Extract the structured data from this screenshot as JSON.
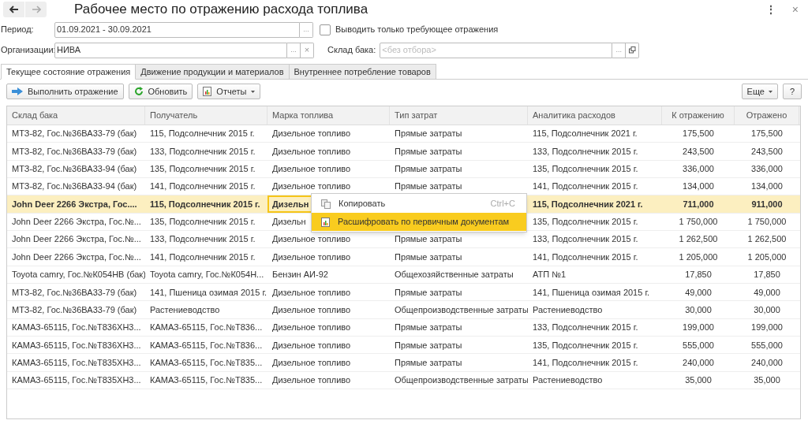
{
  "window": {
    "title": "Рабочее место по отражению расхода топлива",
    "menu_icon": "⋮",
    "close_icon": "×"
  },
  "filters": {
    "period_label": "Период:",
    "period_value": "01.09.2021 - 30.09.2021",
    "only_required": {
      "label": "Выводить только требующее отражения",
      "checked": false
    },
    "org_label": "Организации:",
    "org_value": "НИВА",
    "tank_label": "Склад бака:",
    "tank_placeholder": "<без отбора>",
    "select_dots": "...",
    "clear_icon": "×"
  },
  "tabs": [
    {
      "label": "Текущее состояние отражения",
      "selected": true
    },
    {
      "label": "Движение продукции и материалов",
      "selected": false
    },
    {
      "label": "Внутреннее потребление товаров",
      "selected": false
    }
  ],
  "toolbar": {
    "buttons": [
      {
        "kind": "post",
        "label": "Выполнить отражение"
      },
      {
        "kind": "refresh",
        "label": "Обновить"
      },
      {
        "kind": "reports",
        "label": "Отчеты"
      }
    ],
    "more": "Еще",
    "help": "?"
  },
  "table": {
    "columns": [
      "Склад бака",
      "Получатель",
      "Марка топлива",
      "Тип затрат",
      "Аналитика расходов",
      "К отражению",
      "Отражено"
    ],
    "rows": [
      {
        "selected": false,
        "cells": [
          {
            "text": "МТЗ-82, Гос.№36ВА33-79 (бак)",
            "focused": false
          },
          {
            "text": "115, Подсолнечник 2015 г.",
            "focused": false
          },
          {
            "text": "Дизельное топливо",
            "focused": false
          },
          {
            "text": "Прямые затраты",
            "focused": false
          },
          {
            "text": "115, Подсолнечник 2021 г.",
            "focused": false
          },
          {
            "text": "175,500",
            "focused": false
          },
          {
            "text": "175,500",
            "focused": false
          }
        ]
      },
      {
        "selected": false,
        "cells": [
          {
            "text": "МТЗ-82, Гос.№36ВА33-79 (бак)",
            "focused": false
          },
          {
            "text": "133, Подсолнечник 2015 г.",
            "focused": false
          },
          {
            "text": "Дизельное топливо",
            "focused": false
          },
          {
            "text": "Прямые затраты",
            "focused": false
          },
          {
            "text": "133, Подсолнечник 2015 г.",
            "focused": false
          },
          {
            "text": "243,500",
            "focused": false
          },
          {
            "text": "243,500",
            "focused": false
          }
        ]
      },
      {
        "selected": false,
        "cells": [
          {
            "text": "МТЗ-82, Гос.№36ВА33-94 (бак)",
            "focused": false
          },
          {
            "text": "135, Подсолнечник 2015 г.",
            "focused": false
          },
          {
            "text": "Дизельное топливо",
            "focused": false
          },
          {
            "text": "Прямые затраты",
            "focused": false
          },
          {
            "text": "135, Подсолнечник 2015 г.",
            "focused": false
          },
          {
            "text": "336,000",
            "focused": false
          },
          {
            "text": "336,000",
            "focused": false
          }
        ]
      },
      {
        "selected": false,
        "cells": [
          {
            "text": "МТЗ-82, Гос.№36ВА33-94 (бак)",
            "focused": false
          },
          {
            "text": "141, Подсолнечник 2015 г.",
            "focused": false
          },
          {
            "text": "Дизельное топливо",
            "focused": false
          },
          {
            "text": "Прямые затраты",
            "focused": false
          },
          {
            "text": "141, Подсолнечник 2015 г.",
            "focused": false
          },
          {
            "text": "134,000",
            "focused": false
          },
          {
            "text": "134,000",
            "focused": false
          }
        ]
      },
      {
        "selected": true,
        "cells": [
          {
            "text": "John Deer 2266 Экстра, Гос....",
            "focused": false
          },
          {
            "text": "115, Подсолнечник 2015 г.",
            "focused": false
          },
          {
            "text": "Дизельн",
            "focused": true
          },
          null,
          {
            "text": "115, Подсолнечник 2021 г.",
            "focused": false
          },
          {
            "text": "711,000",
            "focused": false
          },
          {
            "text": "911,000",
            "focused": false
          }
        ]
      },
      {
        "selected": false,
        "cells": [
          {
            "text": "John Deer 2266 Экстра, Гос.№...",
            "focused": false
          },
          {
            "text": "135, Подсолнечник 2015 г.",
            "focused": false
          },
          {
            "text": "Дизельн",
            "focused": false
          },
          null,
          {
            "text": "135, Подсолнечник 2015 г.",
            "focused": false
          },
          {
            "text": "1 750,000",
            "focused": false
          },
          {
            "text": "1 750,000",
            "focused": false
          }
        ]
      },
      {
        "selected": false,
        "cells": [
          {
            "text": "John Deer 2266 Экстра, Гос.№...",
            "focused": false
          },
          {
            "text": "133, Подсолнечник 2015 г.",
            "focused": false
          },
          {
            "text": "Дизельное топливо",
            "focused": false
          },
          {
            "text": "Прямые затраты",
            "focused": false
          },
          {
            "text": "133, Подсолнечник 2015 г.",
            "focused": false
          },
          {
            "text": "1 262,500",
            "focused": false
          },
          {
            "text": "1 262,500",
            "focused": false
          }
        ]
      },
      {
        "selected": false,
        "cells": [
          {
            "text": "John Deer 2266 Экстра, Гос.№...",
            "focused": false
          },
          {
            "text": "141, Подсолнечник 2015 г.",
            "focused": false
          },
          {
            "text": "Дизельное топливо",
            "focused": false
          },
          {
            "text": "Прямые затраты",
            "focused": false
          },
          {
            "text": "141, Подсолнечник 2015 г.",
            "focused": false
          },
          {
            "text": "1 205,000",
            "focused": false
          },
          {
            "text": "1 205,000",
            "focused": false
          }
        ]
      },
      {
        "selected": false,
        "cells": [
          {
            "text": "Toyota camry, Гос.№К054НВ (бак)",
            "focused": false
          },
          {
            "text": "Toyota camry, Гос.№К054Н...",
            "focused": false
          },
          {
            "text": "Бензин АИ-92",
            "focused": false
          },
          {
            "text": "Общехозяйственные затраты",
            "focused": false
          },
          {
            "text": "АТП №1",
            "focused": false
          },
          {
            "text": "17,850",
            "focused": false
          },
          {
            "text": "17,850",
            "focused": false
          }
        ]
      },
      {
        "selected": false,
        "cells": [
          {
            "text": "МТЗ-82, Гос.№36ВА33-79 (бак)",
            "focused": false
          },
          {
            "text": "141, Пшеница озимая 2015 г.",
            "focused": false
          },
          {
            "text": "Дизельное топливо",
            "focused": false
          },
          {
            "text": "Прямые затраты",
            "focused": false
          },
          {
            "text": "141, Пшеница озимая 2015 г.",
            "focused": false
          },
          {
            "text": "49,000",
            "focused": false
          },
          {
            "text": "49,000",
            "focused": false
          }
        ]
      },
      {
        "selected": false,
        "cells": [
          {
            "text": "МТЗ-82, Гос.№36ВА33-79 (бак)",
            "focused": false
          },
          {
            "text": "Растениеводство",
            "focused": false
          },
          {
            "text": "Дизельное топливо",
            "focused": false
          },
          {
            "text": "Общепроизводственные затраты",
            "focused": false
          },
          {
            "text": "Растениеводство",
            "focused": false
          },
          {
            "text": "30,000",
            "focused": false
          },
          {
            "text": "30,000",
            "focused": false
          }
        ]
      },
      {
        "selected": false,
        "cells": [
          {
            "text": "КАМАЗ-65115, Гос.№Т836ХН3...",
            "focused": false
          },
          {
            "text": "КАМАЗ-65115, Гос.№Т836...",
            "focused": false
          },
          {
            "text": "Дизельное топливо",
            "focused": false
          },
          {
            "text": "Прямые затраты",
            "focused": false
          },
          {
            "text": "133, Подсолнечник 2015 г.",
            "focused": false
          },
          {
            "text": "199,000",
            "focused": false
          },
          {
            "text": "199,000",
            "focused": false
          }
        ]
      },
      {
        "selected": false,
        "cells": [
          {
            "text": "КАМАЗ-65115, Гос.№Т836ХН3...",
            "focused": false
          },
          {
            "text": "КАМАЗ-65115, Гос.№Т836...",
            "focused": false
          },
          {
            "text": "Дизельное топливо",
            "focused": false
          },
          {
            "text": "Прямые затраты",
            "focused": false
          },
          {
            "text": "135, Подсолнечник 2015 г.",
            "focused": false
          },
          {
            "text": "555,000",
            "focused": false
          },
          {
            "text": "555,000",
            "focused": false
          }
        ]
      },
      {
        "selected": false,
        "cells": [
          {
            "text": "КАМАЗ-65115, Гос.№Т835ХН3...",
            "focused": false
          },
          {
            "text": "КАМАЗ-65115, Гос.№Т835...",
            "focused": false
          },
          {
            "text": "Дизельное топливо",
            "focused": false
          },
          {
            "text": "Прямые затраты",
            "focused": false
          },
          {
            "text": "141, Подсолнечник 2015 г.",
            "focused": false
          },
          {
            "text": "240,000",
            "focused": false
          },
          {
            "text": "240,000",
            "focused": false
          }
        ]
      },
      {
        "selected": false,
        "cells": [
          {
            "text": "КАМАЗ-65115, Гос.№Т835ХН3...",
            "focused": false
          },
          {
            "text": "КАМАЗ-65115, Гос.№Т835...",
            "focused": false
          },
          {
            "text": "Дизельное топливо",
            "focused": false
          },
          {
            "text": "Общепроизводственные затраты",
            "focused": false
          },
          {
            "text": "Растениеводство",
            "focused": false
          },
          {
            "text": "35,000",
            "focused": false
          },
          {
            "text": "35,000",
            "focused": false
          }
        ]
      }
    ]
  },
  "context_menu": {
    "items": [
      {
        "kind": "copy",
        "label": "Копировать",
        "shortcut": "Ctrl+C",
        "selected": false
      },
      {
        "kind": "report",
        "label": "Расшифровать по первичным документам",
        "selected": true
      }
    ]
  }
}
